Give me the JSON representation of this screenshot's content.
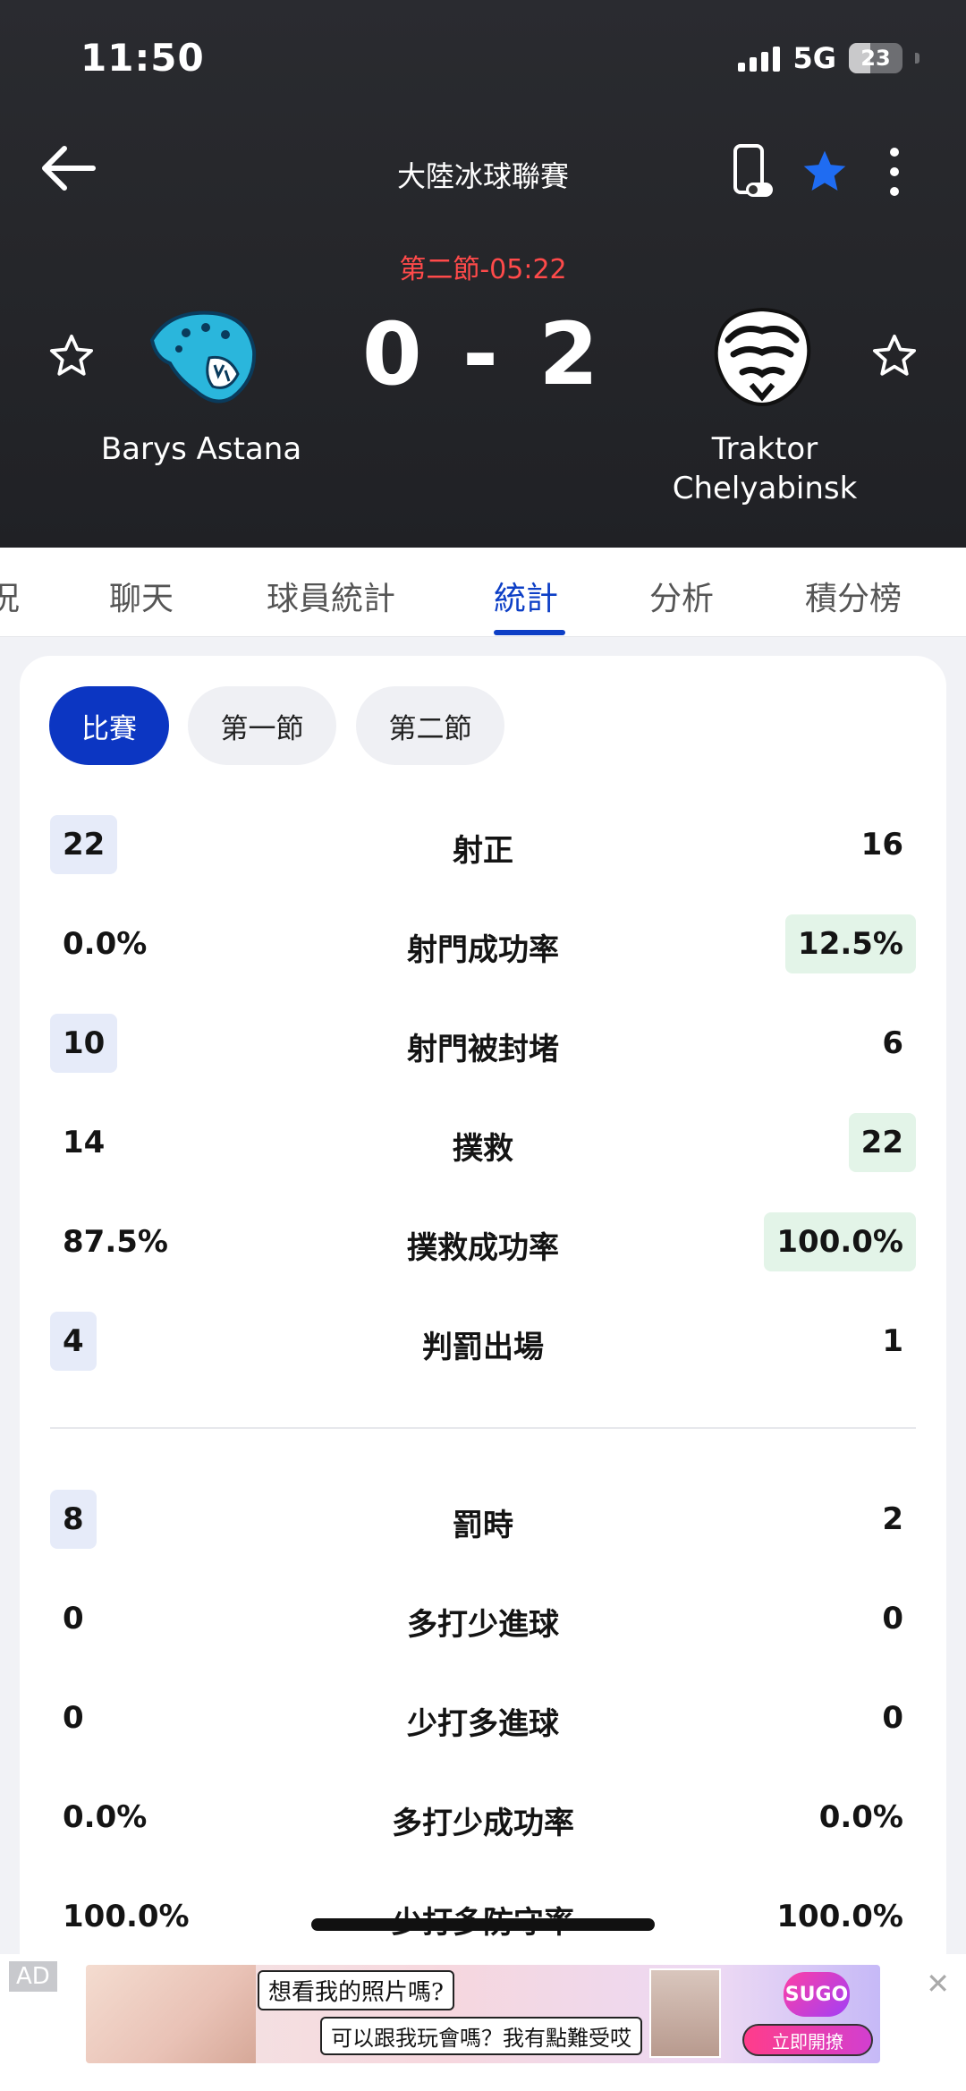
{
  "status_bar": {
    "time": "11:50",
    "network": "5G",
    "battery": "23"
  },
  "top_bar": {
    "league_title": "大陸冰球聯賽"
  },
  "match": {
    "period_time": "第二節-05:22",
    "score": "0 - 2",
    "home_team": "Barys Astana",
    "away_team": "Traktor Chelyabinsk",
    "home_logo_color": "#2ab6dc",
    "away_logo_color": "#111111"
  },
  "tabs": [
    {
      "label": "況"
    },
    {
      "label": "聊天"
    },
    {
      "label": "球員統計"
    },
    {
      "label": "統計"
    },
    {
      "label": "分析"
    },
    {
      "label": "積分榜"
    }
  ],
  "active_tab": "統計",
  "period_chips": [
    {
      "label": "比賽"
    },
    {
      "label": "第一節"
    },
    {
      "label": "第二節"
    }
  ],
  "stats": [
    {
      "label": "射正",
      "home": "22",
      "away": "16"
    },
    {
      "label": "射門成功率",
      "home": "0.0%",
      "away": "12.5%"
    },
    {
      "label": "射門被封堵",
      "home": "10",
      "away": "6"
    },
    {
      "label": "撲救",
      "home": "14",
      "away": "22"
    },
    {
      "label": "撲救成功率",
      "home": "87.5%",
      "away": "100.0%"
    },
    {
      "label": "判罰出場",
      "home": "4",
      "away": "1"
    },
    {
      "label": "罰時",
      "home": "8",
      "away": "2"
    },
    {
      "label": "多打少進球",
      "home": "0",
      "away": "0"
    },
    {
      "label": "少打多進球",
      "home": "0",
      "away": "0"
    },
    {
      "label": "多打少成功率",
      "home": "0.0%",
      "away": "0.0%"
    },
    {
      "label": "少打多防守率",
      "home": "100.0%",
      "away": "100.0%"
    }
  ],
  "ad": {
    "tag": "AD",
    "bubble1": "想看我的照片嗎?",
    "bubble2": "可以跟我玩會嗎？我有點難受哎",
    "brand": "SUGO",
    "cta": "立即開撩",
    "close": "✕"
  },
  "colors": {
    "accent": "#0c36c2",
    "period": "#ff4a4a",
    "home_highlight": "#e6ebf9",
    "away_highlight": "#e3f4e8"
  }
}
